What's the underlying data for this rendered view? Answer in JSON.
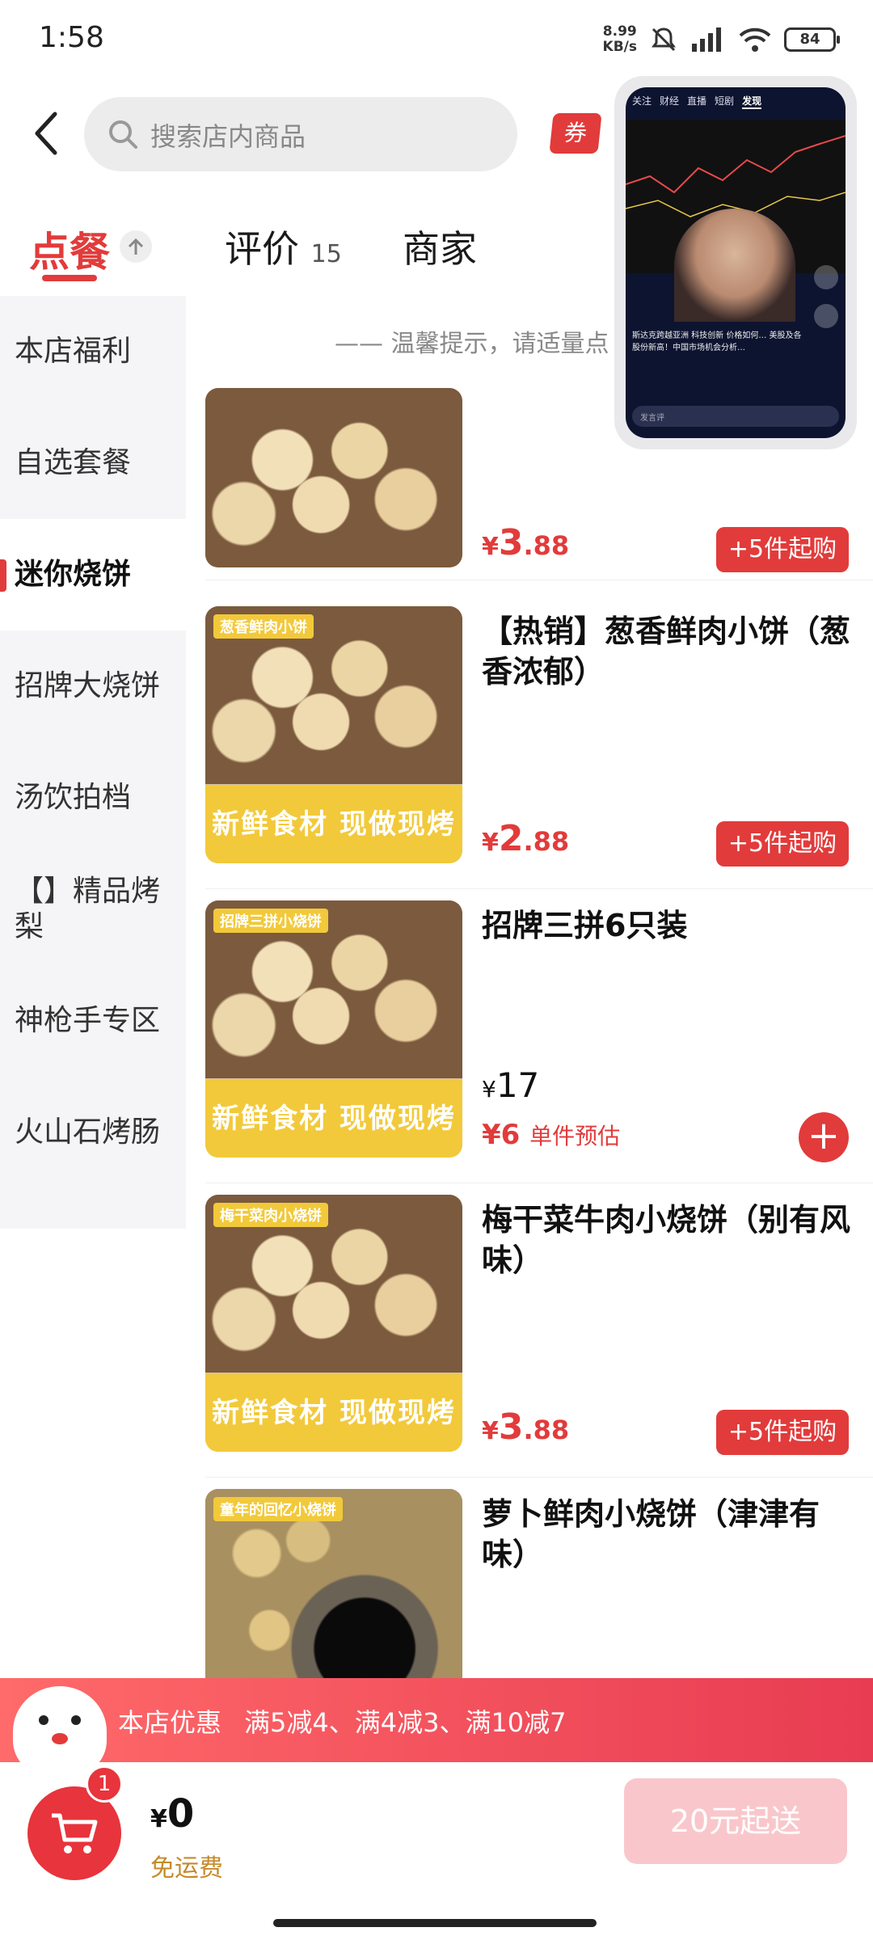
{
  "status": {
    "time": "1:58",
    "net_speed_top": "8.99",
    "net_speed_bottom": "KB/s",
    "battery": "84"
  },
  "header": {
    "search_placeholder": "搜索店内商品",
    "coupon_label": "券"
  },
  "pip": {
    "tabs": [
      "关注",
      "财经",
      "直播",
      "短剧",
      "发现"
    ],
    "caption": "斯达克跨越亚洲 科技创新 价格如何… 美股及各股份新高！中国市场机会分析…",
    "input_placeholder": "发言评"
  },
  "tabs": {
    "order": "点餐",
    "review": "评价",
    "review_count": "15",
    "merchant": "商家"
  },
  "sidebar": {
    "items": [
      {
        "label": "本店福利"
      },
      {
        "label": "自选套餐"
      },
      {
        "label": "迷你烧饼"
      },
      {
        "label": "招牌大烧饼"
      },
      {
        "label": "汤饮拍档"
      },
      {
        "label": "【】精品烤梨"
      },
      {
        "label": "神枪手专区"
      },
      {
        "label": "火山石烤肠"
      }
    ]
  },
  "tip": "—— 温馨提示，请适量点",
  "products": [
    {
      "name": "",
      "yen": "¥",
      "price_int": "3",
      "price_dec": ".88",
      "button": "+5件起购",
      "tag": "",
      "banner": ""
    },
    {
      "name": "【热销】葱香鲜肉小饼（葱香浓郁）",
      "yen": "¥",
      "price_int": "2",
      "price_dec": ".88",
      "button": "+5件起购",
      "tag": "葱香鲜肉小饼",
      "banner": "新鲜食材 现做现烤"
    },
    {
      "name": "招牌三拼6只装",
      "yen": "¥",
      "orig_price": "17",
      "estimate_price": "¥6",
      "estimate_label": "单件预估",
      "add_symbol": "+",
      "tag": "招牌三拼小烧饼",
      "banner": "新鲜食材 现做现烤"
    },
    {
      "name": "梅干菜牛肉小烧饼（别有风味）",
      "yen": "¥",
      "price_int": "3",
      "price_dec": ".88",
      "button": "+5件起购",
      "tag": "梅干菜肉小烧饼",
      "banner": "新鲜食材 现做现烤"
    },
    {
      "name": "萝卜鲜肉小烧饼（津津有味）",
      "tag": "童年的回忆小烧饼"
    }
  ],
  "promo": {
    "title": "本店优惠",
    "text": "满5减4、满4减3、满10减7"
  },
  "cart": {
    "badge": "1",
    "yen": "¥",
    "amount": "0",
    "shipping": "免运费",
    "checkout": "20元起送"
  },
  "colors": {
    "accent": "#e23b3b",
    "sidebar_bg": "#f5f5f7",
    "banner_yellow": "#f2c93a"
  }
}
